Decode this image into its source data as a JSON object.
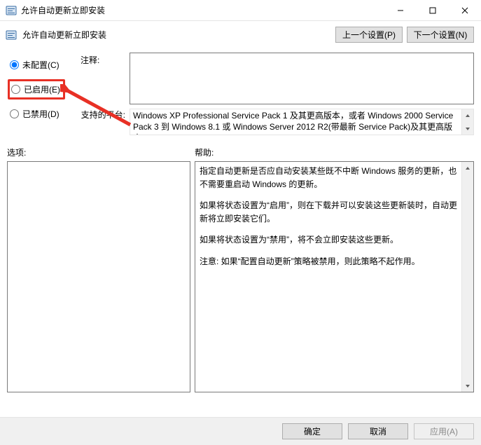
{
  "window": {
    "title": "允许自动更新立即安装"
  },
  "header": {
    "title": "允许自动更新立即安装",
    "prev_btn": "上一个设置(P)",
    "next_btn": "下一个设置(N)"
  },
  "radios": {
    "not_configured": "未配置(C)",
    "enabled": "已启用(E)",
    "disabled": "已禁用(D)",
    "selected": "not_configured"
  },
  "comment": {
    "label": "注释:",
    "value": ""
  },
  "platforms": {
    "label": "支持的平台:",
    "text": "Windows XP Professional Service Pack 1 及其更高版本，或者 Windows 2000 Service Pack 3 到 Windows 8.1 或 Windows Server 2012 R2(带最新 Service Pack)及其更高版本"
  },
  "sections": {
    "options_label": "选项:",
    "help_label": "帮助:"
  },
  "help": {
    "p1": "指定自动更新是否应自动安装某些既不中断 Windows 服务的更新，也不需要重启动 Windows 的更新。",
    "p2": "如果将状态设置为“启用”，则在下载并可以安装这些更新装时，自动更新将立即安装它们。",
    "p3": "如果将状态设置为“禁用”，将不会立即安装这些更新。",
    "p4": "注意: 如果“配置自动更新”策略被禁用，则此策略不起作用。"
  },
  "footer": {
    "ok": "确定",
    "cancel": "取消",
    "apply": "应用(A)"
  }
}
